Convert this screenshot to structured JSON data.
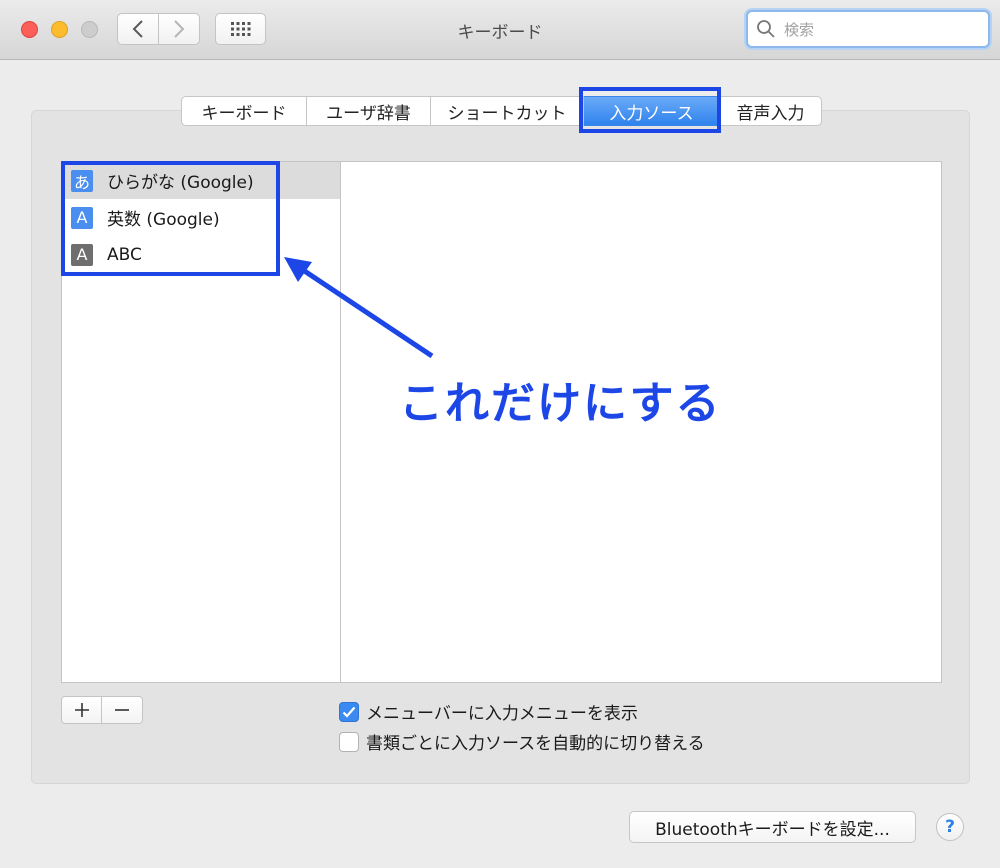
{
  "window": {
    "title": "キーボード"
  },
  "toolbar": {
    "back_icon": "chevron-left-icon",
    "forward_icon": "chevron-right-icon",
    "grid_icon": "grid-icon"
  },
  "search": {
    "placeholder": "検索",
    "value": ""
  },
  "tabs": [
    {
      "label": "キーボード",
      "selected": false
    },
    {
      "label": "ユーザ辞書",
      "selected": false
    },
    {
      "label": "ショートカット",
      "selected": false
    },
    {
      "label": "入力ソース",
      "selected": true
    },
    {
      "label": "音声入力",
      "selected": false
    }
  ],
  "input_sources": [
    {
      "icon_text": "あ",
      "icon_color": "#4a8ef0",
      "label": "ひらがな (Google)",
      "selected": true
    },
    {
      "icon_text": "A",
      "icon_color": "#4a8ef0",
      "label": "英数 (Google)",
      "selected": false
    },
    {
      "icon_text": "A",
      "icon_color": "#6e6e6e",
      "label": "ABC",
      "selected": false
    }
  ],
  "list_buttons": {
    "add": "+",
    "remove": "−"
  },
  "options": [
    {
      "label": "メニューバーに入力メニューを表示",
      "checked": true
    },
    {
      "label": "書類ごとに入力ソースを自動的に切り替える",
      "checked": false
    }
  ],
  "annotation": {
    "text": "これだけにする",
    "color": "#1c46e6"
  },
  "footer": {
    "bluetooth_button": "Bluetoothキーボードを設定...",
    "help": "?"
  },
  "colors": {
    "accent": "#2f83ee",
    "highlight": "#1c46e6"
  }
}
